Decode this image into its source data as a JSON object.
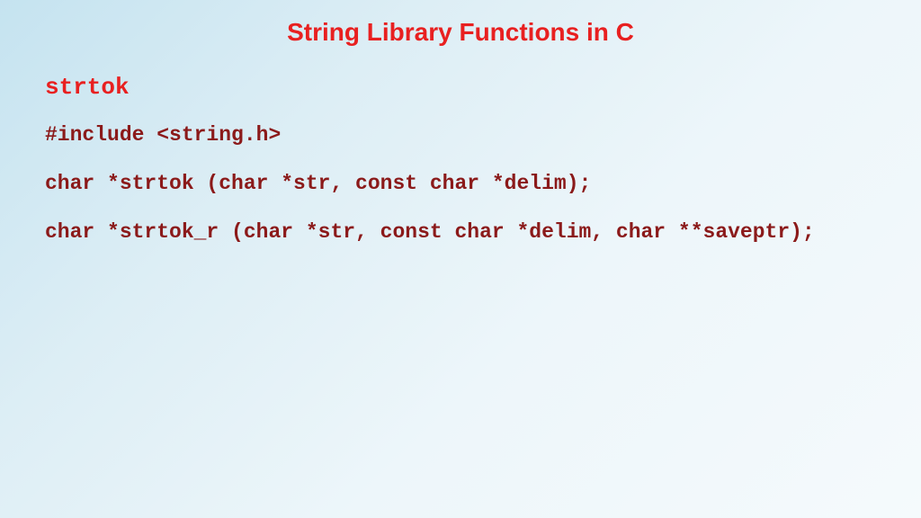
{
  "slide": {
    "title": "String Library Functions in C",
    "section": "strtok",
    "lines": {
      "include": "#include <string.h>",
      "proto1": "char *strtok (char *str, const char *delim);",
      "proto2": "char *strtok_r (char *str, const char *delim, char **saveptr);"
    }
  }
}
